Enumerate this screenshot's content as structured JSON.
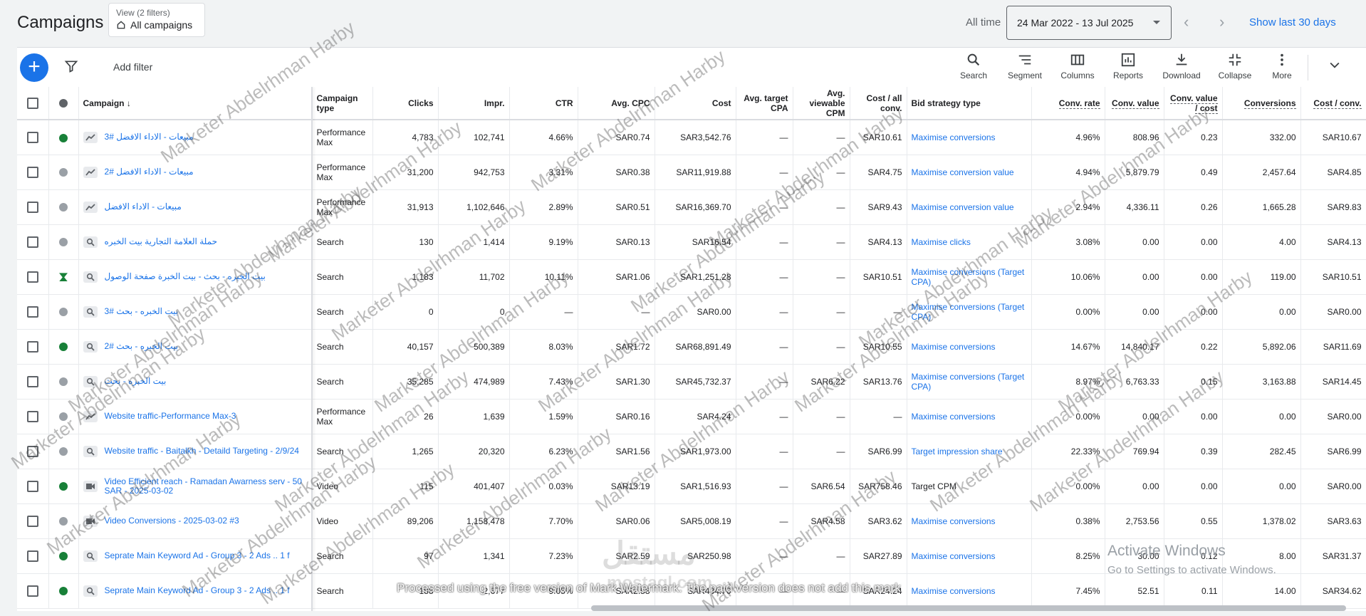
{
  "header": {
    "title": "Campaigns",
    "view_small": "View (2 filters)",
    "view_label": "All campaigns",
    "all_time": "All time",
    "date_range": "24 Mar 2022 - 13 Jul 2025",
    "show_last": "Show last 30 days"
  },
  "toolbar": {
    "add_filter": "Add filter",
    "search": "Search",
    "segment": "Segment",
    "columns": "Columns",
    "reports": "Reports",
    "download": "Download",
    "collapse": "Collapse",
    "more": "More"
  },
  "table": {
    "headers": {
      "campaign": "Campaign",
      "type": "Campaign type",
      "clicks": "Clicks",
      "impr": "Impr.",
      "ctr": "CTR",
      "cpc": "Avg. CPC",
      "cost": "Cost",
      "tcpa": "Avg. target CPA",
      "vcpm": "Avg. viewable CPM",
      "costall": "Cost / all conv.",
      "bid": "Bid strategy type",
      "convrate": "Conv. rate",
      "convval": "Conv. value",
      "valcost": "Conv. value / cost",
      "conv": "Conversions",
      "costconv": "Cost / conv."
    },
    "rows": [
      {
        "status": "enabled",
        "icon": "pmax",
        "name": "مبيعات - الاداء الافضل #3",
        "type": "Performance Max",
        "clicks": "4,783",
        "impr": "102,741",
        "ctr": "4.66%",
        "cpc": "SAR0.74",
        "cost": "SAR3,542.76",
        "tcpa": "—",
        "vcpm": "—",
        "costall": "SAR10.61",
        "bid": "Maximise conversions",
        "bid_link": true,
        "convrate": "4.96%",
        "convval": "808.96",
        "valcost": "0.23",
        "conv": "332.00",
        "costconv": "SAR10.67"
      },
      {
        "status": "paused",
        "icon": "pmax",
        "name": "مبيعات - الاداء الافضل #2",
        "type": "Performance Max",
        "clicks": "31,200",
        "impr": "942,753",
        "ctr": "3.31%",
        "cpc": "SAR0.38",
        "cost": "SAR11,919.88",
        "tcpa": "—",
        "vcpm": "—",
        "costall": "SAR4.75",
        "bid": "Maximise conversion value",
        "bid_link": true,
        "convrate": "4.94%",
        "convval": "5,879.79",
        "valcost": "0.49",
        "conv": "2,457.64",
        "costconv": "SAR4.85"
      },
      {
        "status": "paused",
        "icon": "pmax",
        "name": "مبيعات - الاداء الافضل",
        "type": "Performance Max",
        "clicks": "31,913",
        "impr": "1,102,646",
        "ctr": "2.89%",
        "cpc": "SAR0.51",
        "cost": "SAR16,369.70",
        "tcpa": "—",
        "vcpm": "—",
        "costall": "SAR9.43",
        "bid": "Maximise conversion value",
        "bid_link": true,
        "convrate": "2.94%",
        "convval": "4,336.11",
        "valcost": "0.26",
        "conv": "1,665.28",
        "costconv": "SAR9.83"
      },
      {
        "status": "paused",
        "icon": "search",
        "name": "حملة العلامة التجارية بيت الخبره",
        "type": "Search",
        "clicks": "130",
        "impr": "1,414",
        "ctr": "9.19%",
        "cpc": "SAR0.13",
        "cost": "SAR16.54",
        "tcpa": "—",
        "vcpm": "—",
        "costall": "SAR4.13",
        "bid": "Maximise clicks",
        "bid_link": true,
        "convrate": "3.08%",
        "convval": "0.00",
        "valcost": "0.00",
        "conv": "4.00",
        "costconv": "SAR4.13"
      },
      {
        "status": "learning",
        "icon": "search",
        "name": "بيت الخبره - بحث - بيت الخبرة صفحة الوصول",
        "type": "Search",
        "clicks": "1,183",
        "impr": "11,702",
        "ctr": "10.11%",
        "cpc": "SAR1.06",
        "cost": "SAR1,251.28",
        "tcpa": "—",
        "vcpm": "—",
        "costall": "SAR10.51",
        "bid": "Maximise conversions (Target CPA)",
        "bid_link": true,
        "convrate": "10.06%",
        "convval": "0.00",
        "valcost": "0.00",
        "conv": "119.00",
        "costconv": "SAR10.51"
      },
      {
        "status": "paused",
        "icon": "search",
        "name": "بيت الخبره - بحث #3",
        "type": "Search",
        "clicks": "0",
        "impr": "0",
        "ctr": "—",
        "cpc": "—",
        "cost": "SAR0.00",
        "tcpa": "—",
        "vcpm": "—",
        "costall": "—",
        "bid": "Maximise conversions (Target CPA)",
        "bid_link": true,
        "convrate": "0.00%",
        "convval": "0.00",
        "valcost": "0.00",
        "conv": "0.00",
        "costconv": "SAR0.00"
      },
      {
        "status": "enabled",
        "icon": "search",
        "name": "بيت الخبره - بحث #2",
        "type": "Search",
        "clicks": "40,157",
        "impr": "500,389",
        "ctr": "8.03%",
        "cpc": "SAR1.72",
        "cost": "SAR68,891.49",
        "tcpa": "—",
        "vcpm": "—",
        "costall": "SAR10.55",
        "bid": "Maximise conversions",
        "bid_link": true,
        "convrate": "14.67%",
        "convval": "14,840.17",
        "valcost": "0.22",
        "conv": "5,892.06",
        "costconv": "SAR11.69"
      },
      {
        "status": "paused",
        "icon": "search",
        "name": "بيت الخبره - بحث",
        "type": "Search",
        "clicks": "35,285",
        "impr": "474,989",
        "ctr": "7.43%",
        "cpc": "SAR1.30",
        "cost": "SAR45,732.37",
        "tcpa": "—",
        "vcpm": "SAR6.22",
        "costall": "SAR13.76",
        "bid": "Maximise conversions (Target CPA)",
        "bid_link": true,
        "convrate": "8.97%",
        "convval": "6,763.33",
        "valcost": "0.15",
        "conv": "3,163.88",
        "costconv": "SAR14.45"
      },
      {
        "status": "paused",
        "icon": "pmax",
        "name": "Website traffic-Performance Max-3",
        "type": "Performance Max",
        "clicks": "26",
        "impr": "1,639",
        "ctr": "1.59%",
        "cpc": "SAR0.16",
        "cost": "SAR4.24",
        "tcpa": "—",
        "vcpm": "—",
        "costall": "—",
        "bid": "Maximise conversions",
        "bid_link": true,
        "convrate": "0.00%",
        "convval": "0.00",
        "valcost": "0.00",
        "conv": "0.00",
        "costconv": "SAR0.00"
      },
      {
        "status": "paused",
        "icon": "search",
        "name": "Website traffic - Baitalkh - Detaild Targeting - 2/9/24",
        "type": "Search",
        "clicks": "1,265",
        "impr": "20,320",
        "ctr": "6.23%",
        "cpc": "SAR1.56",
        "cost": "SAR1,973.00",
        "tcpa": "—",
        "vcpm": "—",
        "costall": "SAR6.99",
        "bid": "Target impression share",
        "bid_link": true,
        "convrate": "22.33%",
        "convval": "769.94",
        "valcost": "0.39",
        "conv": "282.45",
        "costconv": "SAR6.99"
      },
      {
        "status": "enabled",
        "icon": "video",
        "name": "Video Efficient reach - Ramadan Awarness serv - 50 SAR - 2025-03-02",
        "type": "Video",
        "clicks": "115",
        "impr": "401,407",
        "ctr": "0.03%",
        "cpc": "SAR13.19",
        "cost": "SAR1,516.93",
        "tcpa": "—",
        "vcpm": "SAR6.54",
        "costall": "SAR758.46",
        "bid": "Target CPM",
        "bid_link": false,
        "convrate": "0.00%",
        "convval": "0.00",
        "valcost": "0.00",
        "conv": "0.00",
        "costconv": "SAR0.00"
      },
      {
        "status": "paused",
        "icon": "video",
        "name": "Video Conversions - 2025-03-02 #3",
        "type": "Video",
        "clicks": "89,206",
        "impr": "1,158,478",
        "ctr": "7.70%",
        "cpc": "SAR0.06",
        "cost": "SAR5,008.19",
        "tcpa": "—",
        "vcpm": "SAR4.58",
        "costall": "SAR3.62",
        "bid": "Maximise conversions",
        "bid_link": true,
        "convrate": "0.38%",
        "convval": "2,753.56",
        "valcost": "0.55",
        "conv": "1,378.02",
        "costconv": "SAR3.63"
      },
      {
        "status": "enabled",
        "icon": "search",
        "name": "Seprate Main Keyword Ad - Group 3 - 2 Ads .. 1 f",
        "type": "Search",
        "clicks": "97",
        "impr": "1,341",
        "ctr": "7.23%",
        "cpc": "SAR2.59",
        "cost": "SAR250.98",
        "tcpa": "—",
        "vcpm": "—",
        "costall": "SAR27.89",
        "bid": "Maximise conversions",
        "bid_link": true,
        "convrate": "8.25%",
        "convval": "30.00",
        "valcost": "0.12",
        "conv": "8.00",
        "costconv": "SAR31.37"
      },
      {
        "status": "enabled",
        "icon": "search",
        "name": "Seprate Main Keyword Ad - Group 3 - 2 Ads .. 1 f",
        "type": "Search",
        "clicks": "188",
        "impr": "2,677",
        "ctr": "9.05%",
        "cpc": "SAR2.58",
        "cost": "SAR484.70",
        "tcpa": "—",
        "vcpm": "—",
        "costall": "SAR24.24",
        "bid": "Maximise conversions",
        "bid_link": true,
        "convrate": "7.45%",
        "convval": "52.51",
        "valcost": "0.11",
        "conv": "14.00",
        "costconv": "SAR34.62"
      }
    ]
  },
  "overlay": {
    "watermark": "Marketer Abdelrhman Harby",
    "activate_title": "Activate Windows",
    "activate_sub": "Go to Settings to activate Windows.",
    "processed": "Processed using the free version of Mark Watermark. The paid version does not add this mark",
    "logo_ar": "مستقل",
    "logo_en": "mostaql.com"
  },
  "colors": {
    "accent": "#1a73e8",
    "enabled": "#188038",
    "paused": "#9aa0a6"
  }
}
